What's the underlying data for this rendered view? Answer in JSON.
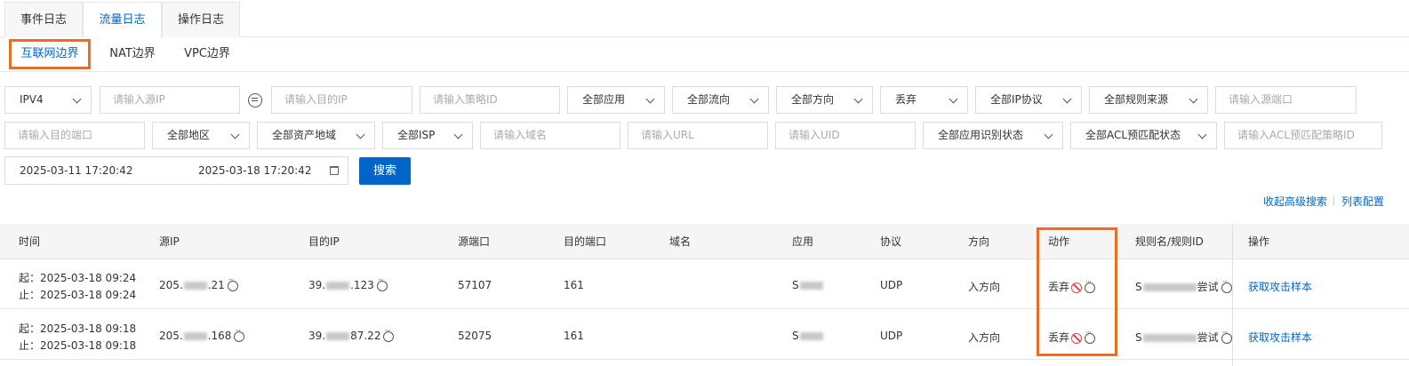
{
  "tabs": [
    {
      "label": "事件日志"
    },
    {
      "label": "流量日志"
    },
    {
      "label": "操作日志"
    }
  ],
  "subtabs": [
    {
      "label": "互联网边界"
    },
    {
      "label": "NAT边界"
    },
    {
      "label": "VPC边界"
    }
  ],
  "filters": {
    "ip_version": "IPV4",
    "src_ip_placeholder": "请输入源IP",
    "dst_ip_placeholder": "请输入目的IP",
    "policy_id_placeholder": "请输入策略ID",
    "app": "全部应用",
    "flow": "全部流向",
    "direction": "全部方向",
    "action": "丢弃",
    "ip_protocol": "全部IP协议",
    "rule_source": "全部规则来源",
    "src_port_placeholder": "请输入源端口",
    "dst_port_placeholder": "请输入目的端口",
    "region": "全部地区",
    "asset_region": "全部资产地域",
    "isp": "全部ISP",
    "domain_placeholder": "请输入域名",
    "url_placeholder": "请输入URL",
    "uid_placeholder": "请输入UID",
    "app_identify_status": "全部应用识别状态",
    "acl_prematch_status": "全部ACL预匹配状态",
    "acl_prematch_policy_placeholder": "请输入ACL预匹配策略ID",
    "date_start": "2025-03-11 17:20:42",
    "date_end": "2025-03-18 17:20:42",
    "search_label": "搜索"
  },
  "links": {
    "collapse_advanced": "收起高级搜索",
    "column_config": "列表配置"
  },
  "table": {
    "headers": {
      "time": "时间",
      "src_ip": "源IP",
      "dst_ip": "目的IP",
      "src_port": "源端口",
      "dst_port": "目的端口",
      "domain": "域名",
      "app": "应用",
      "protocol": "协议",
      "direction": "方向",
      "action": "动作",
      "rule": "规则名/规则ID",
      "operation": "操作"
    },
    "rows": [
      {
        "start": "起：2025-03-18 09:24",
        "end": "止：2025-03-18 09:24",
        "src_ip_prefix": "205.",
        "src_ip_suffix": ".21",
        "dst_ip_prefix": "39.",
        "dst_ip_suffix": ".123",
        "src_port": "57107",
        "dst_port": "161",
        "domain": "",
        "app_prefix": "S",
        "protocol": "UDP",
        "direction": "入方向",
        "action": "丢弃",
        "rule_prefix": "S",
        "rule_suffix": "尝试",
        "operation": "获取攻击样本"
      },
      {
        "start": "起：2025-03-18 09:18",
        "end": "止：2025-03-18 09:18",
        "src_ip_prefix": "205.",
        "src_ip_suffix": ".168",
        "dst_ip_prefix": "39.",
        "dst_ip_suffix": "87.22",
        "src_port": "52075",
        "dst_port": "161",
        "domain": "",
        "app_prefix": "S",
        "protocol": "UDP",
        "direction": "入方向",
        "action": "丢弃",
        "rule_prefix": "S",
        "rule_suffix": "尝试",
        "operation": "获取攻击样本"
      }
    ]
  },
  "colors": {
    "accent": "#0064c8",
    "highlight": "#ed6c23",
    "danger": "#e04545"
  }
}
